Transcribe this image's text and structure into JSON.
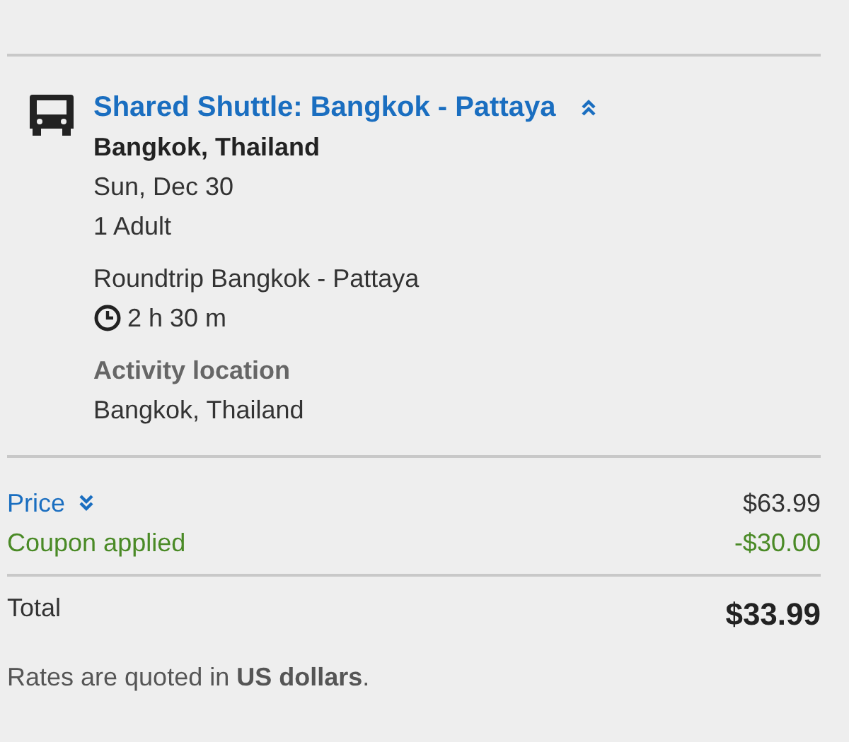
{
  "activity": {
    "title": "Shared Shuttle: Bangkok - Pattaya",
    "expanded": true,
    "location": "Bangkok, Thailand",
    "date": "Sun, Dec 30",
    "travelers": "1 Adult",
    "description": "Roundtrip Bangkok - Pattaya",
    "duration": "2 h 30 m",
    "location_heading": "Activity location",
    "location_detail": "Bangkok, Thailand"
  },
  "price": {
    "label": "Price",
    "expanded": false,
    "amount": "$63.99",
    "coupon_label": "Coupon applied",
    "coupon_amount": "-$30.00",
    "total_label": "Total",
    "total_amount": "$33.99"
  },
  "note": "Rates are quoted in **US dollars**."
}
